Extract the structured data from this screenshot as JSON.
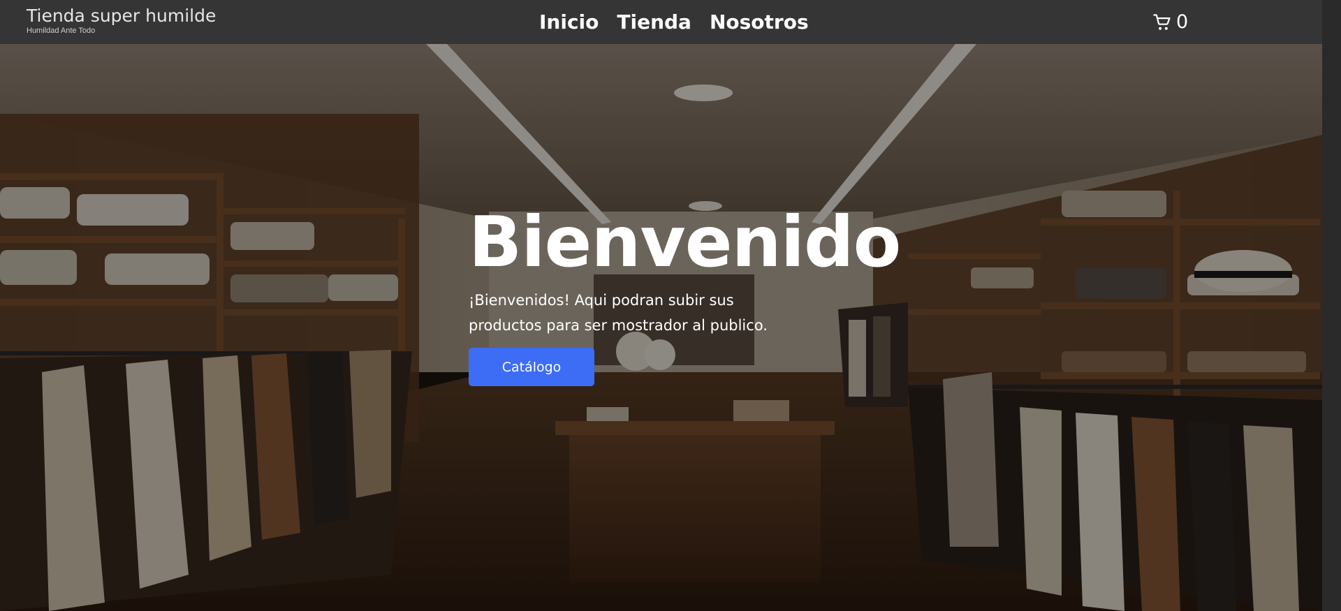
{
  "brand": {
    "title": "Tienda super humilde",
    "subtitle": "Humildad Ante Todo"
  },
  "nav": {
    "links": [
      {
        "label": "Inicio"
      },
      {
        "label": "Tienda"
      },
      {
        "label": "Nosotros"
      }
    ]
  },
  "cart": {
    "icon": "shopping-cart-icon",
    "count": "0"
  },
  "hero": {
    "title": "Bienvenido",
    "text": "¡Bienvenidos! Aqui podran subir sus productos para ser mostrador al publico.",
    "button_label": "Catálogo",
    "background": "clothing-store-interior-photo"
  },
  "colors": {
    "navbar": "#353535",
    "button": "#3d6df5",
    "text": "#ffffff"
  }
}
